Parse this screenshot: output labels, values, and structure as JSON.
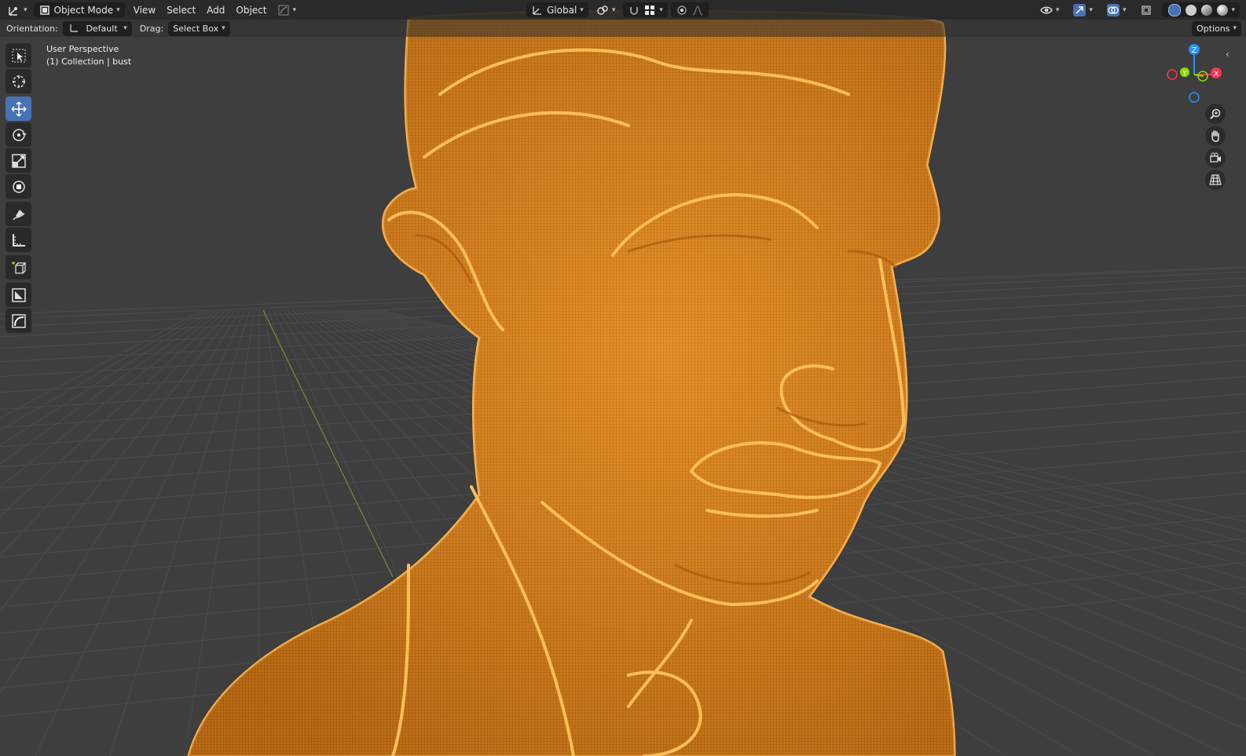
{
  "header": {
    "editor_type_icon": "camera-axes-icon",
    "mode": "Object Mode",
    "menus": [
      "View",
      "Select",
      "Add",
      "Object"
    ],
    "transform_orientation": "Global"
  },
  "tool_settings": {
    "orientation_label": "Orientation:",
    "orientation_value": "Default",
    "drag_label": "Drag:",
    "drag_value": "Select Box",
    "options_label": "Options"
  },
  "toolbar": {
    "tools": [
      "select-box",
      "cursor",
      "move",
      "rotate",
      "scale",
      "transform",
      "annotate",
      "measure",
      "add-cube",
      "shrink-flatten",
      "curve"
    ],
    "active_tool": "move"
  },
  "viewport": {
    "view_name": "User Perspective",
    "collection_info": "(1) Collection | bust",
    "object_color": "#f59a2a",
    "background_color": "#3e3e3e"
  },
  "gizmo": {
    "axes": [
      "X",
      "Y",
      "Z"
    ],
    "colors": {
      "x": "#ff3352",
      "y": "#8bdc00",
      "z": "#2890ff"
    }
  },
  "nav_buttons": [
    "zoom-icon",
    "pan-hand-icon",
    "camera-icon",
    "grid-ortho-icon"
  ]
}
